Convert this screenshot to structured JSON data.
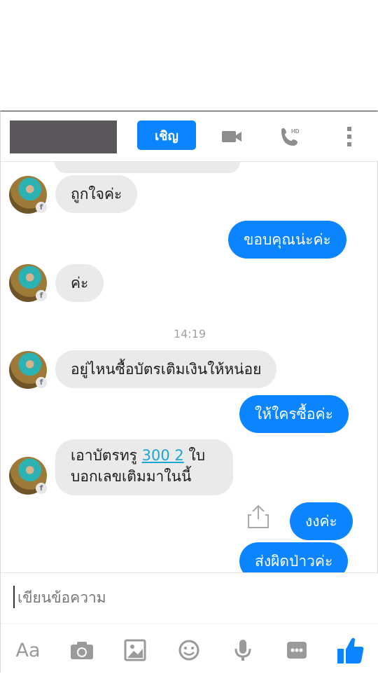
{
  "header": {
    "invite_label": "เชิญ",
    "icons": [
      "video-icon",
      "phone-hd-icon",
      "more-vertical-icon"
    ]
  },
  "messages": {
    "m1": "ถูกใจค่ะ",
    "m2": "ขอบคุณน่ะค่ะ",
    "m3": "ค่ะ",
    "time": "14:19",
    "m4": "อยู่ไหนซื้อบัตรเติมเงินให้หน่อย",
    "m5": "ให้ใครซื้อค่ะ",
    "m6_part1": "เอาบัตรทรู ",
    "m6_link": "300  2",
    "m6_part2": "  ใบ",
    "m6_line2": "บอกเลขเติมมาในนี้",
    "m7": "งงค่ะ",
    "m8": "ส่งผิดป่าวค่ะ"
  },
  "composer": {
    "placeholder": "เขียนข้อความ"
  },
  "toolbar": {
    "aa_label": "Aa",
    "icons": [
      "text-format-icon",
      "camera-icon",
      "gallery-icon",
      "emoji-icon",
      "mic-icon",
      "more-icon",
      "like-icon"
    ]
  }
}
